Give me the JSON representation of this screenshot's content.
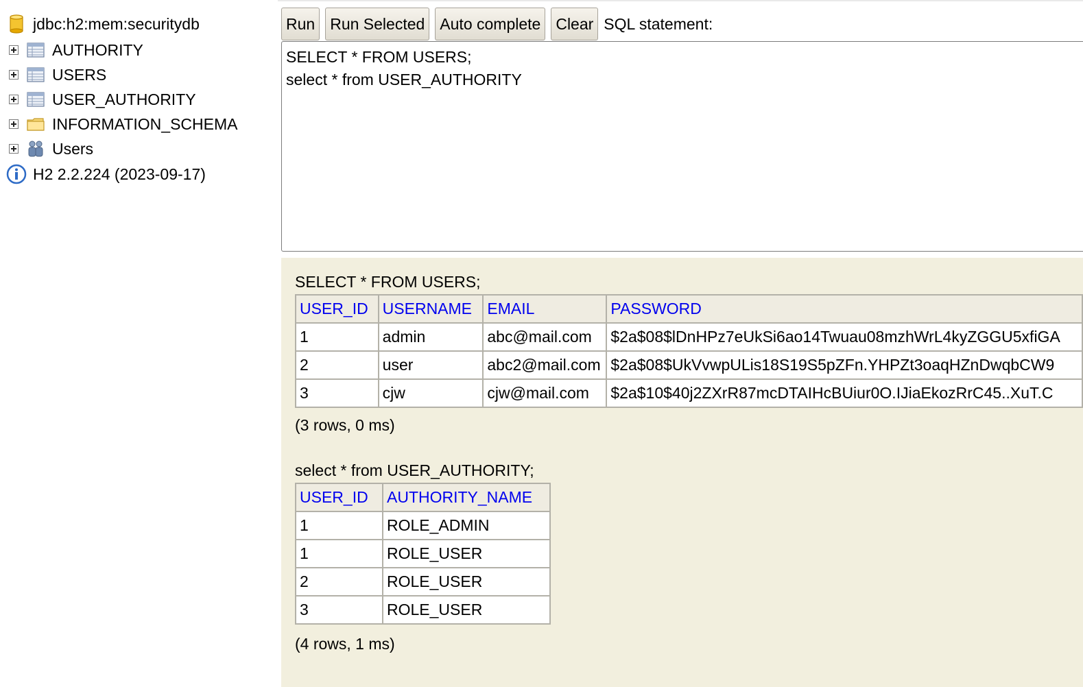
{
  "tree": {
    "connection": "jdbc:h2:mem:securitydb",
    "items": [
      {
        "label": "AUTHORITY"
      },
      {
        "label": "USERS"
      },
      {
        "label": "USER_AUTHORITY"
      },
      {
        "label": "INFORMATION_SCHEMA"
      },
      {
        "label": "Users"
      }
    ],
    "version": "H2 2.2.224 (2023-09-17)"
  },
  "toolbar": {
    "run": "Run",
    "run_selected": "Run Selected",
    "auto_complete": "Auto complete",
    "clear": "Clear",
    "sql_label": "SQL statement:"
  },
  "editor": {
    "text": "SELECT * FROM USERS;\nselect * from USER_AUTHORITY"
  },
  "results": {
    "users": {
      "query": "SELECT * FROM USERS;",
      "columns": [
        "USER_ID",
        "USERNAME",
        "EMAIL",
        "PASSWORD"
      ],
      "rows": [
        [
          "1",
          "admin",
          "abc@mail.com",
          "$2a$08$lDnHPz7eUkSi6ao14Twuau08mzhWrL4kyZGGU5xfiGA"
        ],
        [
          "2",
          "user",
          "abc2@mail.com",
          "$2a$08$UkVvwpULis18S19S5pZFn.YHPZt3oaqHZnDwqbCW9"
        ],
        [
          "3",
          "cjw",
          "cjw@mail.com",
          "$2a$10$40j2ZXrR87mcDTAIHcBUiur0O.IJiaEkozRrC45..XuT.C"
        ]
      ],
      "stats": "(3 rows, 0 ms)"
    },
    "user_authority": {
      "query": "select * from USER_AUTHORITY;",
      "columns": [
        "USER_ID",
        "AUTHORITY_NAME"
      ],
      "rows": [
        [
          "1",
          "ROLE_ADMIN"
        ],
        [
          "1",
          "ROLE_USER"
        ],
        [
          "2",
          "ROLE_USER"
        ],
        [
          "3",
          "ROLE_USER"
        ]
      ],
      "stats": "(4 rows, 1 ms)"
    }
  },
  "colors": {
    "results_bg": "#f2efde",
    "header_text": "#0000ee",
    "header_bg": "#efece1",
    "border": "#b3b1a8"
  }
}
